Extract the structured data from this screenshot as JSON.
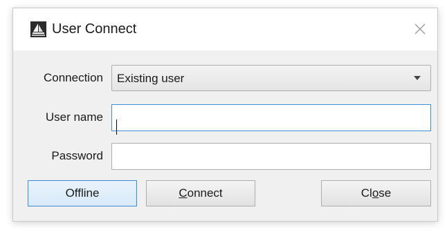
{
  "window": {
    "title": "User Connect",
    "app_icon": "sailboat-logo-icon",
    "close_icon": "close-icon"
  },
  "form": {
    "connection": {
      "label": "Connection",
      "value": "Existing user",
      "arrow_icon": "chevron-down-icon"
    },
    "username": {
      "label": "User name",
      "value": ""
    },
    "password": {
      "label": "Password",
      "value": ""
    }
  },
  "buttons": {
    "offline": {
      "label": "Offline"
    },
    "connect": {
      "pre": "",
      "mnemonic": "C",
      "post": "onnect"
    },
    "close": {
      "pre": "Cl",
      "mnemonic": "o",
      "post": "se"
    }
  },
  "colors": {
    "dialog_bg": "#f0f0f0",
    "titlebar_bg": "#ffffff",
    "focus_border": "#3a8fd8",
    "default_button_border": "#3c8ad6"
  }
}
